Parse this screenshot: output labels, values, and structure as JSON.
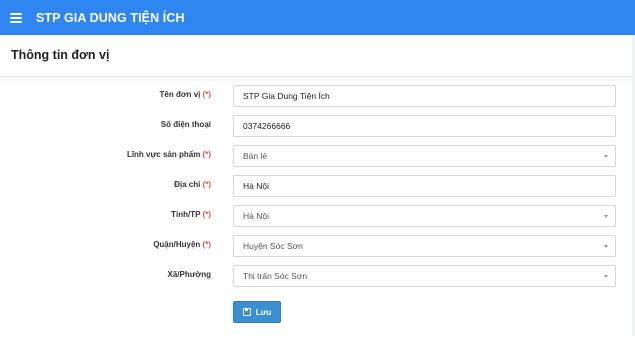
{
  "header": {
    "app_title": "STP GIA DUNG TIỆN ÍCH"
  },
  "page": {
    "title": "Thông tin đơn vị"
  },
  "form": {
    "required_mark": "(*)",
    "fields": [
      {
        "label": "Tên đơn vị",
        "required": true,
        "type": "input",
        "value": "STP Gia Dung Tiện Ích"
      },
      {
        "label": "Số điện thoại",
        "required": false,
        "type": "input",
        "value": "0374266666"
      },
      {
        "label": "Lĩnh vực sản phẩm",
        "required": true,
        "type": "select",
        "value": "Bán lẻ"
      },
      {
        "label": "Địa chỉ",
        "required": true,
        "type": "input",
        "value": "Hà Nội"
      },
      {
        "label": "Tỉnh/TP",
        "required": true,
        "type": "select",
        "value": "Hà Nội"
      },
      {
        "label": "Quận/Huyện",
        "required": true,
        "type": "select",
        "value": "Huyện Sóc Sơn"
      },
      {
        "label": "Xã/Phường",
        "required": false,
        "type": "select",
        "value": "Thị trấn Sóc Sơn"
      }
    ],
    "save_label": "Lưu"
  },
  "colors": {
    "topbar": "#2f86f0",
    "save_button": "#3b8fd1",
    "required": "#d9534f"
  },
  "icons": {
    "menu": "hamburger-icon",
    "save": "floppy-disk-icon",
    "dropdown": "caret-down-icon"
  }
}
